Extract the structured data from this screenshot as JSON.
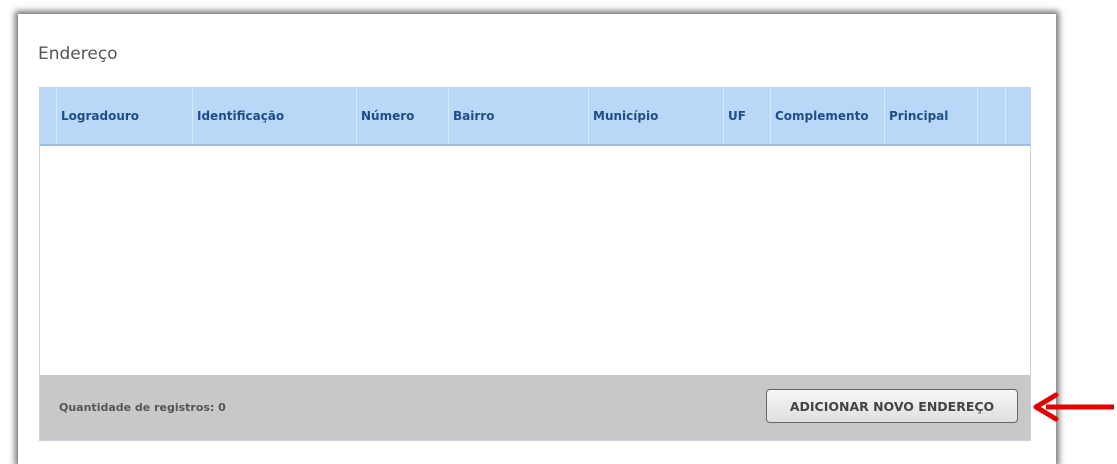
{
  "section": {
    "title": "Endereço"
  },
  "grid": {
    "columns": [
      {
        "label": "Logradouro"
      },
      {
        "label": "Identificação"
      },
      {
        "label": "Número"
      },
      {
        "label": "Bairro"
      },
      {
        "label": "Município"
      },
      {
        "label": "UF"
      },
      {
        "label": "Complemento"
      },
      {
        "label": "Principal"
      },
      {
        "label": ""
      },
      {
        "label": ""
      }
    ],
    "rows": [],
    "footer": {
      "count_label": "Quantidade de registros: 0",
      "add_button_label": "ADICIONAR NOVO ENDEREÇO"
    }
  },
  "colors": {
    "header_bg": "#b9d7f6",
    "header_text": "#1f4e88",
    "footer_bg": "#c8c8c8",
    "arrow": "#e00000"
  },
  "icons": {
    "annotation": "arrow-left-icon"
  }
}
